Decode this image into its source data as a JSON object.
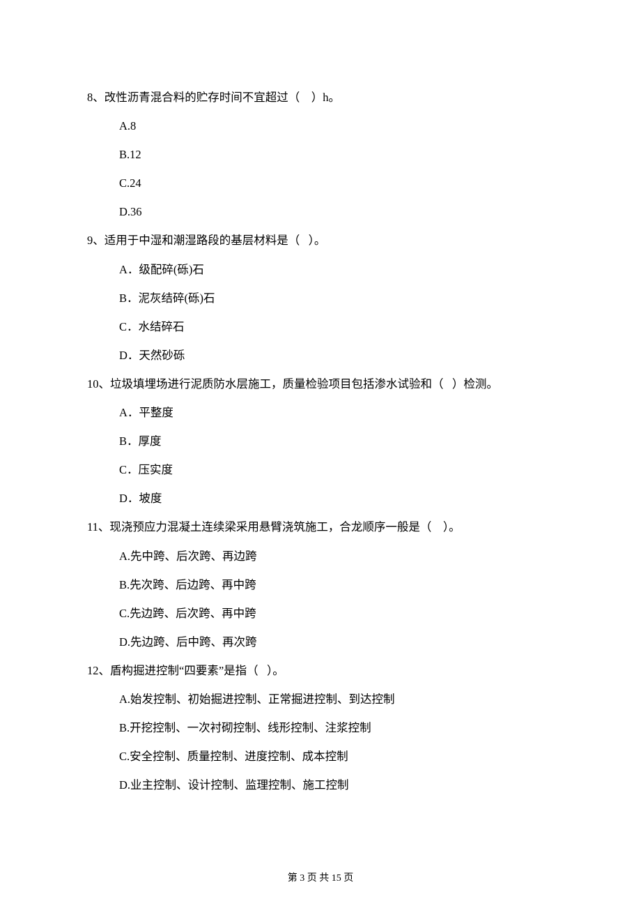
{
  "questions": [
    {
      "number": "8、",
      "stem_before": "改性沥青混合料的贮存时间不宜超过（",
      "stem_after": "）h。",
      "options": [
        "A.8",
        "B.12",
        "C.24",
        "D.36"
      ]
    },
    {
      "number": "9、",
      "stem_before": "适用于中湿和潮湿路段的基层材料是（",
      "stem_after": "）。",
      "options": [
        "A．级配碎(砾)石",
        "B．泥灰结碎(砾)石",
        "C．水结碎石",
        "D．天然砂砾"
      ]
    },
    {
      "number": "10、",
      "stem_before": "垃圾填埋场进行泥质防水层施工，质量检验项目包括渗水试验和（",
      "stem_after": "）检测。",
      "options": [
        "A．平整度",
        "B．厚度",
        "C．压实度",
        "D．坡度"
      ]
    },
    {
      "number": "11、",
      "stem_before": "现浇预应力混凝土连续梁采用悬臂浇筑施工，合龙顺序一般是（",
      "stem_after": "）。",
      "options": [
        "A.先中跨、后次跨、再边跨",
        "B.先次跨、后边跨、再中跨",
        "C.先边跨、后次跨、再中跨",
        "D.先边跨、后中跨、再次跨"
      ]
    },
    {
      "number": "12、",
      "stem_before": "盾构掘进控制“四要素”是指（",
      "stem_after": "）。",
      "options": [
        "A.始发控制、初始掘进控制、正常掘进控制、到达控制",
        "B.开挖控制、一次衬砌控制、线形控制、注浆控制",
        "C.安全控制、质量控制、进度控制、成本控制",
        "D.业主控制、设计控制、监理控制、施工控制"
      ]
    }
  ],
  "footer": "第 3 页 共 15 页"
}
